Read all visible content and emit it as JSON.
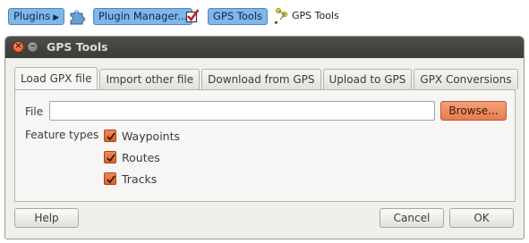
{
  "breadcrumb": {
    "plugins_label": "Plugins",
    "plugins_arrow": "▶",
    "plugin_manager_label": "Plugin Manager...",
    "gps_tools_label": "GPS Tools",
    "gps_tools_text": "GPS Tools"
  },
  "window": {
    "close_glyph": "×",
    "minimize_glyph": "–",
    "title": "GPS Tools"
  },
  "tabs": [
    {
      "label": "Load GPX file",
      "active": true
    },
    {
      "label": "Import other file",
      "active": false
    },
    {
      "label": "Download from GPS",
      "active": false
    },
    {
      "label": "Upload to GPS",
      "active": false
    },
    {
      "label": "GPX Conversions",
      "active": false
    }
  ],
  "load_gpx": {
    "file_label": "File",
    "file_value": "",
    "browse_label": "Browse...",
    "feature_types_label": "Feature types",
    "feature_types": [
      {
        "label": "Waypoints",
        "checked": true
      },
      {
        "label": "Routes",
        "checked": true
      },
      {
        "label": "Tracks",
        "checked": true
      }
    ]
  },
  "buttons": {
    "help_label": "Help",
    "cancel_label": "Cancel",
    "ok_label": "OK"
  },
  "colors": {
    "accent_orange": "#e77c4e",
    "breadcrumb_blue": "#7fb8e8",
    "titlebar_dark": "#3c3b37"
  },
  "icons": {
    "puzzle": "puzzle-piece-icon",
    "check": "checkbox-checked-icon",
    "gps": "gps-tools-icon"
  }
}
